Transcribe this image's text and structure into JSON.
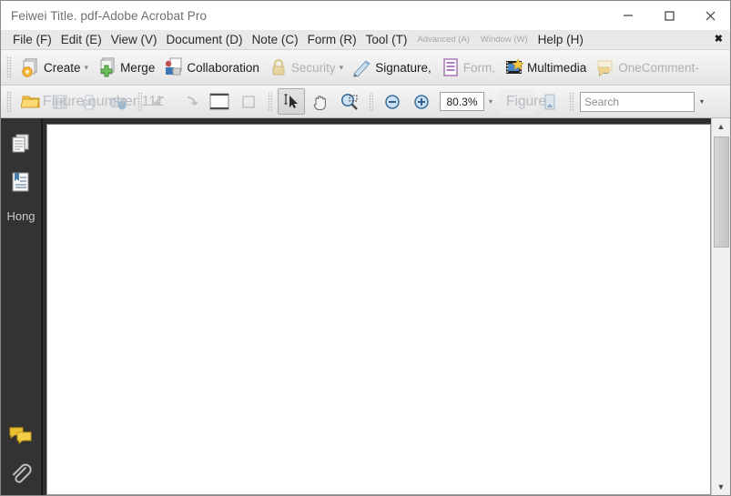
{
  "window": {
    "title": "Feiwei Title. pdf-Adobe Acrobat Pro",
    "minimize_label": "minimize-icon",
    "maximize_label": "maximize-icon",
    "close_label": "close-icon"
  },
  "menubar": {
    "items": [
      {
        "label": "File (F)",
        "dim": false
      },
      {
        "label": "Edit (E)",
        "dim": false
      },
      {
        "label": "View (V)",
        "dim": false
      },
      {
        "label": "Document (D)",
        "dim": false
      },
      {
        "label": "Note (C)",
        "dim": false
      },
      {
        "label": "Form (R)",
        "dim": false
      },
      {
        "label": "Tool (T)",
        "dim": false
      },
      {
        "label": "Advanced (A)",
        "dim": true
      },
      {
        "label": "Window (W)",
        "dim": true
      },
      {
        "label": "Help (H)",
        "dim": false
      }
    ],
    "close_label": "✖"
  },
  "toolbar_main": {
    "buttons": [
      {
        "label": "Create",
        "icon": "create-document-icon",
        "caret": "▾",
        "disabled": false
      },
      {
        "label": "Merge",
        "icon": "merge-plus-icon",
        "caret": "",
        "disabled": false
      },
      {
        "label": "Collaboration",
        "icon": "collaboration-icon",
        "caret": "",
        "disabled": false
      },
      {
        "label": "Security",
        "icon": "security-lock-icon",
        "caret": "▾",
        "disabled": true
      },
      {
        "label": "Signature,",
        "icon": "signature-pen-icon",
        "caret": "",
        "disabled": false
      },
      {
        "label": "Form,",
        "icon": "form-icon",
        "caret": "",
        "disabled": true
      },
      {
        "label": "Multimedia",
        "icon": "multimedia-film-icon",
        "caret": "",
        "disabled": false
      },
      {
        "label": "OneComment-",
        "icon": "comment-bubble-icon",
        "caret": "",
        "disabled": true
      }
    ]
  },
  "toolbar_secondary": {
    "ghost_label": "Figure number 111",
    "open_icon": "open-folder-icon",
    "save_icon": "save-icon",
    "print_icon": "print-icon",
    "email_icon": "email-icon",
    "prev_page_icon": "previous-page-icon",
    "next_page_icon": "next-page-icon",
    "page_view_icon": "page-view-icon",
    "select_tool_icon": "select-tool-icon",
    "hand_tool_icon": "hand-tool-icon",
    "marquee_zoom_icon": "marquee-zoom-icon",
    "zoom_out_icon": "zoom-out-icon",
    "zoom_in_icon": "zoom-in-icon",
    "zoom_value": "80.3%",
    "zoom_dropdown_caret": "▾",
    "figure_button_label": "Figure",
    "figure_tool_icon": "figure-tool-icon",
    "search_placeholder": "Search",
    "search_value": "",
    "search_caret": "▾"
  },
  "sidebar": {
    "items": [
      {
        "name": "pages-panel",
        "icon": "pages-thumbnail-icon"
      },
      {
        "name": "bookmarks-panel",
        "icon": "bookmarks-icon"
      }
    ],
    "label": "Hong",
    "bottom_items": [
      {
        "name": "comments-panel",
        "icon": "comments-icon"
      },
      {
        "name": "attachments-panel",
        "icon": "attachment-paperclip-icon"
      }
    ]
  },
  "scrollbar": {
    "up_arrow": "▲",
    "down_arrow": "▼"
  },
  "colors": {
    "titlebar_bg": "#ffffff",
    "menubar_bg": "#e9e9e9",
    "toolbar_bg": "#ededed",
    "sidebar_bg": "#333333",
    "page_bg": "#ffffff",
    "accent_blue": "#3a7bbf"
  }
}
